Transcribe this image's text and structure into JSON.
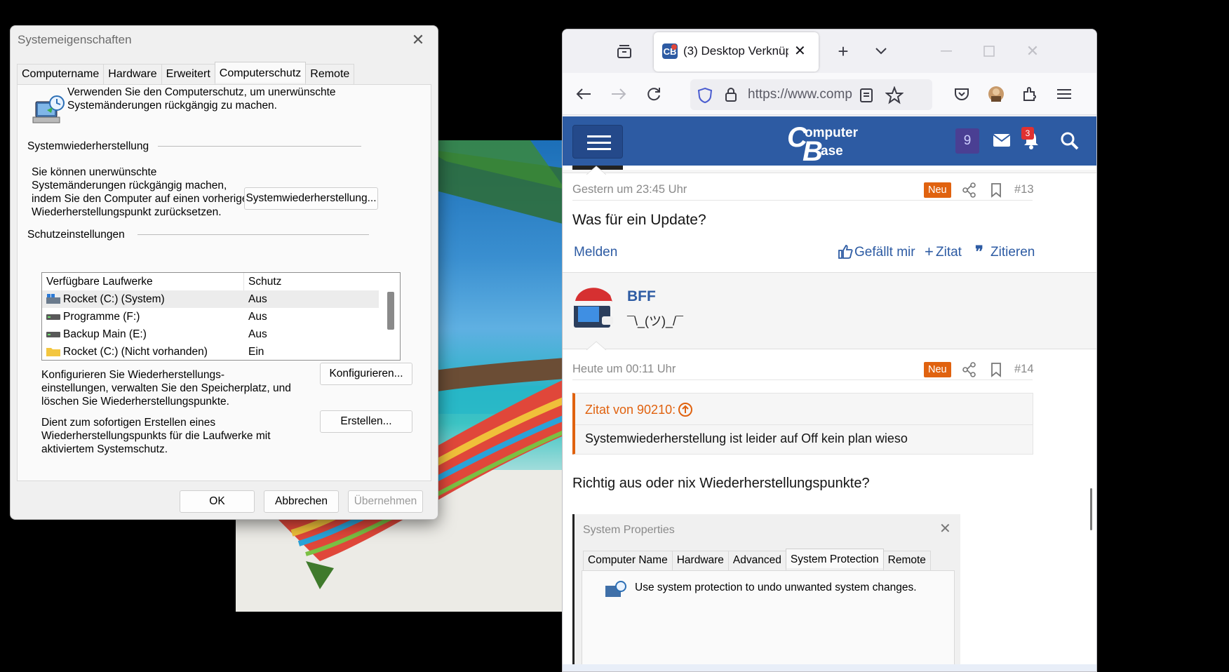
{
  "dialog": {
    "title": "Systemeigenschaften",
    "tabs": [
      "Computername",
      "Hardware",
      "Erweitert",
      "Computerschutz",
      "Remote"
    ],
    "active_tab": "Computerschutz",
    "intro_line1": "Verwenden Sie den Computerschutz, um unerwünschte",
    "intro_line2": "Systemänderungen rückgängig zu machen.",
    "restore_section": "Systemwiederherstellung",
    "restore_text": [
      "Sie können unerwünschte",
      "Systemänderungen rückgängig machen,",
      "indem Sie den Computer auf einen vorherigen",
      "Wiederherstellungspunkt zurücksetzen."
    ],
    "restore_button": "Systemwiederherstellung...",
    "protection_section": "Schutzeinstellungen",
    "list_headers": [
      "Verfügbare Laufwerke",
      "Schutz"
    ],
    "drives": [
      {
        "name": "Rocket (C:) (System)",
        "status": "Aus",
        "icon": "system-drive-icon"
      },
      {
        "name": "Programme (F:)",
        "status": "Aus",
        "icon": "drive-icon"
      },
      {
        "name": "Backup Main  (E:)",
        "status": "Aus",
        "icon": "drive-icon"
      },
      {
        "name": "Rocket (C:) (Nicht vorhanden)",
        "status": "Ein",
        "icon": "folder-icon"
      }
    ],
    "configure_text": [
      "Konfigurieren Sie Wiederherstellungs-",
      "einstellungen, verwalten Sie den Speicherplatz, und",
      "löschen Sie Wiederherstellungspunkte."
    ],
    "configure_button": "Konfigurieren...",
    "create_text": [
      "Dient zum sofortigen Erstellen eines",
      "Wiederherstellungspunkts für die Laufwerke mit",
      "aktiviertem Systemschutz."
    ],
    "create_button": "Erstellen...",
    "ok": "OK",
    "cancel": "Abbrechen",
    "apply": "Übernehmen"
  },
  "browser": {
    "tab_title": "(3) Desktop Verknüp",
    "url": "https://www.comp",
    "notif_count": "3",
    "alerts_count": "9",
    "logo_top": "omputer",
    "logo_bottom": "ase",
    "posts": [
      {
        "time": "Gestern um 23:45 Uhr",
        "badge": "Neu",
        "num": "#13",
        "body": "Was für ein Update?"
      },
      {
        "time": "Heute um 00:11 Uhr",
        "badge": "Neu",
        "num": "#14",
        "quote_author": "Zitat von 90210:",
        "quote_text": "Systemwiederherstellung ist leider auf Off kein plan wieso",
        "body": "Richtig aus oder nix Wiederherstellungspunkte?"
      }
    ],
    "actions": {
      "report": "Melden",
      "like": "Gefällt mir",
      "quote_plus": "Zitat",
      "quote": "Zitieren"
    },
    "user": {
      "name": "BFF",
      "tagline": "¯\\_(ツ)_/¯"
    },
    "embedded": {
      "title": "System Properties",
      "tabs": [
        "Computer Name",
        "Hardware",
        "Advanced",
        "System Protection",
        "Remote"
      ],
      "text": "Use system protection to undo unwanted system changes."
    }
  }
}
